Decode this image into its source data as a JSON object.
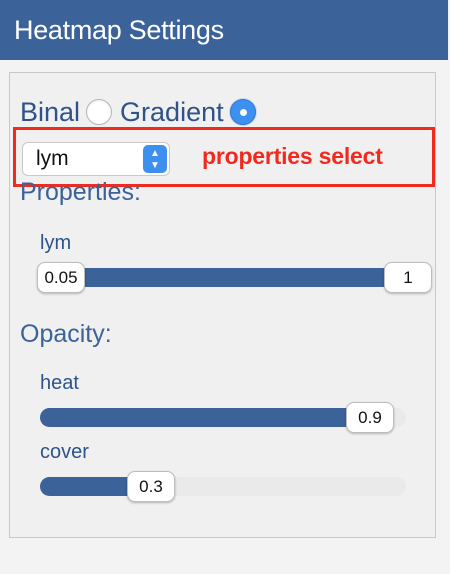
{
  "header": {
    "title": "Heatmap Settings"
  },
  "mode": {
    "options": [
      {
        "label": "Binal",
        "checked": false
      },
      {
        "label": "Gradient",
        "checked": true
      }
    ]
  },
  "properties_select": {
    "value": "lym",
    "annotation": "properties select"
  },
  "properties": {
    "title": "Properties:",
    "sliders": [
      {
        "label": "lym",
        "low": "0.05",
        "high": "1"
      }
    ]
  },
  "opacity": {
    "title": "Opacity:",
    "sliders": [
      {
        "label": "heat",
        "value": "0.9"
      },
      {
        "label": "cover",
        "value": "0.3"
      }
    ]
  },
  "colors": {
    "header_bg": "#3b6299",
    "accent": "#3d8ff0",
    "annotation": "#f02a1e"
  }
}
